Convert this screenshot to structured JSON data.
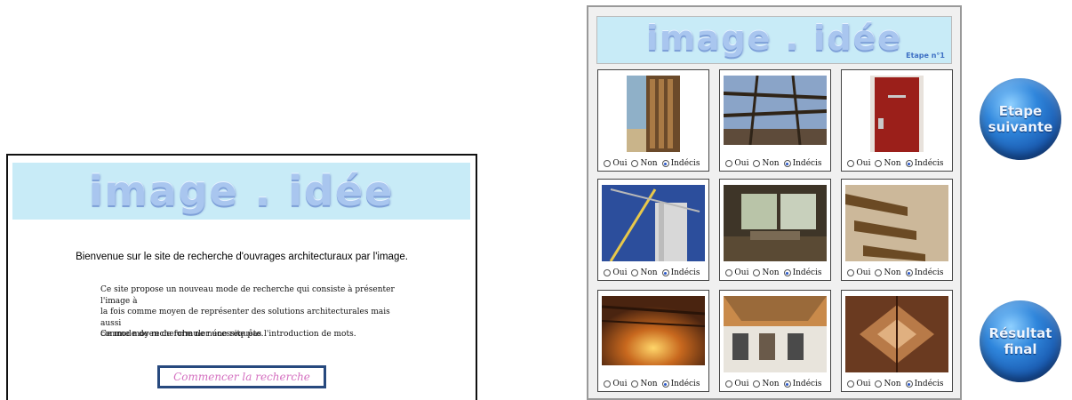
{
  "welcome": {
    "logo": "image . idée",
    "heading": "Bienvenue sur le site de recherche d'ouvrages architecturaux par l'image.",
    "description_lines": [
      "Ce site propose un nouveau mode de recherche qui consiste à présenter l'image à",
      "la fois comme moyen de représenter des solutions architecturales mais aussi",
      "comme moyen de formuler une requête."
    ],
    "note": "Ce mode de recherche ne nécessite pas l'introduction de mots.",
    "start_button": "Commencer la recherche"
  },
  "grid_page": {
    "logo": "image . idée",
    "step_label": "Etape n°1",
    "radio_labels": {
      "yes": "Oui",
      "no": "Non",
      "undecided": "Indécis"
    },
    "selected_option": "Indécis",
    "photos": [
      {
        "subject": "wooden facade slats"
      },
      {
        "subject": "glass roof with beams"
      },
      {
        "subject": "red door"
      },
      {
        "subject": "silo structure"
      },
      {
        "subject": "interior room"
      },
      {
        "subject": "wooden staircase underside"
      },
      {
        "subject": "warm lit timber ceiling"
      },
      {
        "subject": "canopy over street"
      },
      {
        "subject": "interior wood vault"
      }
    ]
  },
  "side_buttons": {
    "next": [
      "Etape",
      "suivante"
    ],
    "final": [
      "Résultat",
      "final"
    ]
  },
  "colors": {
    "banner_bg": "#c8ebf7",
    "logo": "#a9c6ef",
    "step_label": "#3d6fc3",
    "start_button_text": "#d470c0",
    "start_button_border": "#27497e",
    "orb": "#2f86dc"
  }
}
